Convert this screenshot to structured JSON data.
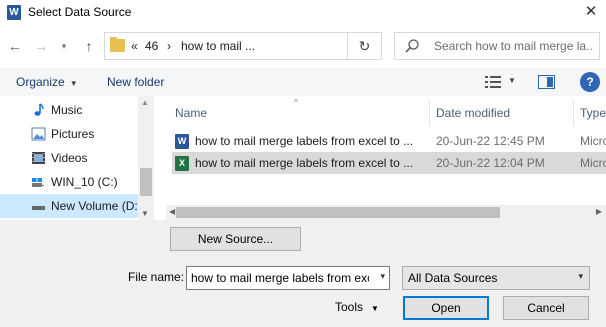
{
  "window": {
    "title": "Select Data Source",
    "app_icon": "W",
    "close_glyph": "✕"
  },
  "nav": {
    "back_glyph": "←",
    "forward_glyph": "→",
    "up_glyph": "↑",
    "breadcrumb": [
      "«",
      "46",
      "›",
      "how to mail ..."
    ],
    "refresh_glyph": "↻",
    "search_placeholder": "Search how to mail merge la..."
  },
  "toolbar": {
    "organize_label": "Organize",
    "new_folder_label": "New folder",
    "help_glyph": "?"
  },
  "sidebar": {
    "items": [
      {
        "label": "Music",
        "icon": "music-icon",
        "selected": false
      },
      {
        "label": "Pictures",
        "icon": "pictures-icon",
        "selected": false
      },
      {
        "label": "Videos",
        "icon": "videos-icon",
        "selected": false
      },
      {
        "label": "WIN_10 (C:)",
        "icon": "drive-icon",
        "selected": false
      },
      {
        "label": "New Volume (D:",
        "icon": "drive-icon",
        "selected": true
      }
    ]
  },
  "filelist": {
    "columns": [
      "Name",
      "Date modified",
      "Type"
    ],
    "rows": [
      {
        "name": "how to mail merge labels from excel to ...",
        "date": "20-Jun-22 12:45 PM",
        "type": "Micro",
        "icon": "word-file-icon",
        "selected": false
      },
      {
        "name": "how to mail merge labels from excel to ...",
        "date": "20-Jun-22 12:04 PM",
        "type": "Micro",
        "icon": "excel-file-icon",
        "selected": true
      }
    ]
  },
  "bottom": {
    "new_source_label": "New Source...",
    "file_name_label": "File name:",
    "file_name_value": "how to mail merge labels from exc",
    "filter_value": "All Data Sources",
    "tools_label": "Tools",
    "open_label": "Open",
    "cancel_label": "Cancel"
  },
  "colors": {
    "word_blue": "#2b579a",
    "excel_green": "#217346",
    "selection_blue": "#cce8ff",
    "accent": "#0078d7"
  }
}
